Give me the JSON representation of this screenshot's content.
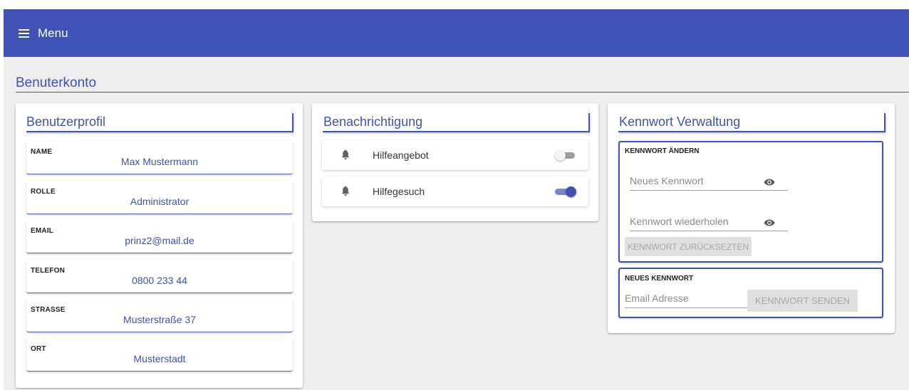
{
  "app_bar": {
    "menu_label": "Menu",
    "color": "#3f51b5"
  },
  "page": {
    "title": "Benuterkonto"
  },
  "profile": {
    "title": "Benutzerprofil",
    "fields": [
      {
        "label": "NAME",
        "value": "Max Mustermann"
      },
      {
        "label": "ROLLE",
        "value": "Administrator"
      },
      {
        "label": "EMAIL",
        "value": "prinz2@mail.de"
      },
      {
        "label": "TELEFON",
        "value": "0800 233 44"
      },
      {
        "label": "STRASSE",
        "value": "Musterstraße 37"
      },
      {
        "label": "ORT",
        "value": "Musterstadt"
      }
    ]
  },
  "notifications": {
    "title": "Benachrichtigung",
    "items": [
      {
        "label": "Hilfeangebot",
        "icon": "bell-icon",
        "enabled": false
      },
      {
        "label": "Hilfegesuch",
        "icon": "bell-icon",
        "enabled": true
      }
    ]
  },
  "password": {
    "title": "Kennwort Verwaltung",
    "change": {
      "title": "KENNWORT ÄNDERN",
      "new_placeholder": "Neues Kennwort",
      "repeat_placeholder": "Kennwort wiederholen",
      "reset_button": "KENNWORT ZURÜCKSEZTEN"
    },
    "new": {
      "title": "NEUES KENNWORT",
      "email_placeholder": "Email Adresse",
      "send_button": "KENNWORT SENDEN"
    }
  }
}
